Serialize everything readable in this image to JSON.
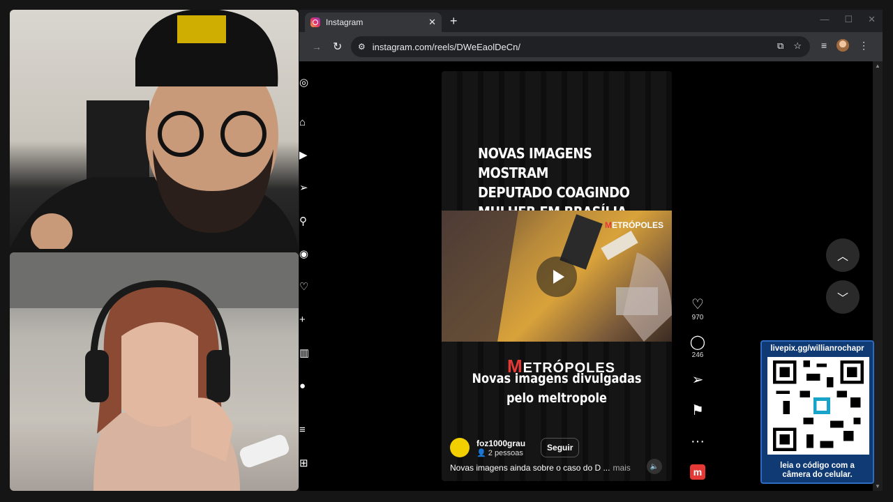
{
  "tab": {
    "title": "Instagram",
    "close": "✕",
    "new_tab": "+"
  },
  "window_controls": {
    "minimize": "—",
    "maximize": "☐",
    "close": "✕"
  },
  "address_bar": {
    "url": "instagram.com/reels/DWeEaolDeCn/"
  },
  "reel": {
    "headline": [
      "NOVAS IMAGENS MOSTRAM",
      "DEPUTADO COAGINDO",
      "MULHER EM BRASÍLIA"
    ],
    "video_brand": "ETRÓPOLES",
    "video_brand_initial": "M",
    "brand_large": "ETRÓPOLES",
    "brand_large_initial": "M",
    "subtitle_line1": "Novas imagens divulgadas",
    "subtitle_line2": "pelo meltropole",
    "author": {
      "handle": "foz1000grau",
      "people": "2 pessoas",
      "follow_label": "Seguir"
    },
    "caption": "Novas imagens ainda sobre o caso do D ...",
    "caption_more": "mais"
  },
  "actions": {
    "likes": "970",
    "comments": "246"
  },
  "qr_overlay": {
    "header": "livepix.gg/willianrochapr",
    "footer_line1": "leia o código com a",
    "footer_line2": "câmera do celular."
  },
  "colors": {
    "tabbar": "#202124",
    "toolbar": "#35363a",
    "brand_red": "#e53935",
    "qr_blue": "#0f3a74"
  },
  "icons": {
    "sidebar": [
      "instagram-icon",
      "home-icon",
      "reels-icon",
      "send-icon",
      "search-icon",
      "explore-icon",
      "heart-icon",
      "plus-icon",
      "stats-icon",
      "profile-avatar",
      "menu-icon",
      "grid-icon"
    ]
  }
}
